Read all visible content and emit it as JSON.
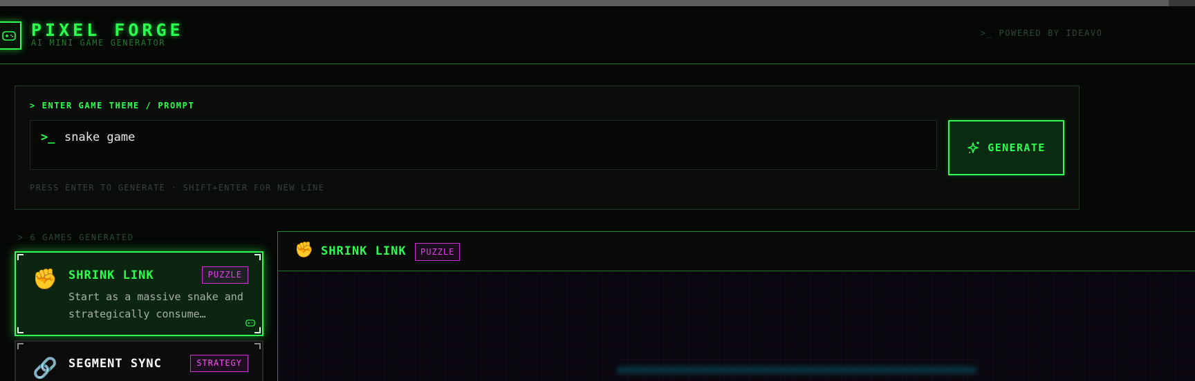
{
  "header": {
    "title": "PIXEL FORGE",
    "subtitle": "AI MINI GAME GENERATOR",
    "powered_by": ">_ POWERED BY IDEAVO",
    "logo_icon": "gamepad-icon"
  },
  "prompt": {
    "label": "> ENTER GAME THEME / PROMPT",
    "caret": ">_",
    "value": "snake game",
    "hint": "PRESS ENTER TO GENERATE · SHIFT+ENTER FOR NEW LINE",
    "generate_label": "GENERATE",
    "generate_icon": "sparkles-icon"
  },
  "games": {
    "count_label": "> 6 GAMES GENERATED",
    "items": [
      {
        "emoji": "✊",
        "title": "SHRINK LINK",
        "tag": "PUZZLE",
        "description": "Start as a massive snake and strategically consume…",
        "active": true
      },
      {
        "emoji": "🔗",
        "title": "SEGMENT SYNC",
        "tag": "STRATEGY",
        "description": "",
        "active": false
      }
    ]
  },
  "preview": {
    "emoji": "✊",
    "title": "SHRINK LINK",
    "tag": "PUZZLE"
  },
  "colors": {
    "accent": "#2bff4f",
    "tag": "#e43ff0",
    "background": "#050705"
  }
}
